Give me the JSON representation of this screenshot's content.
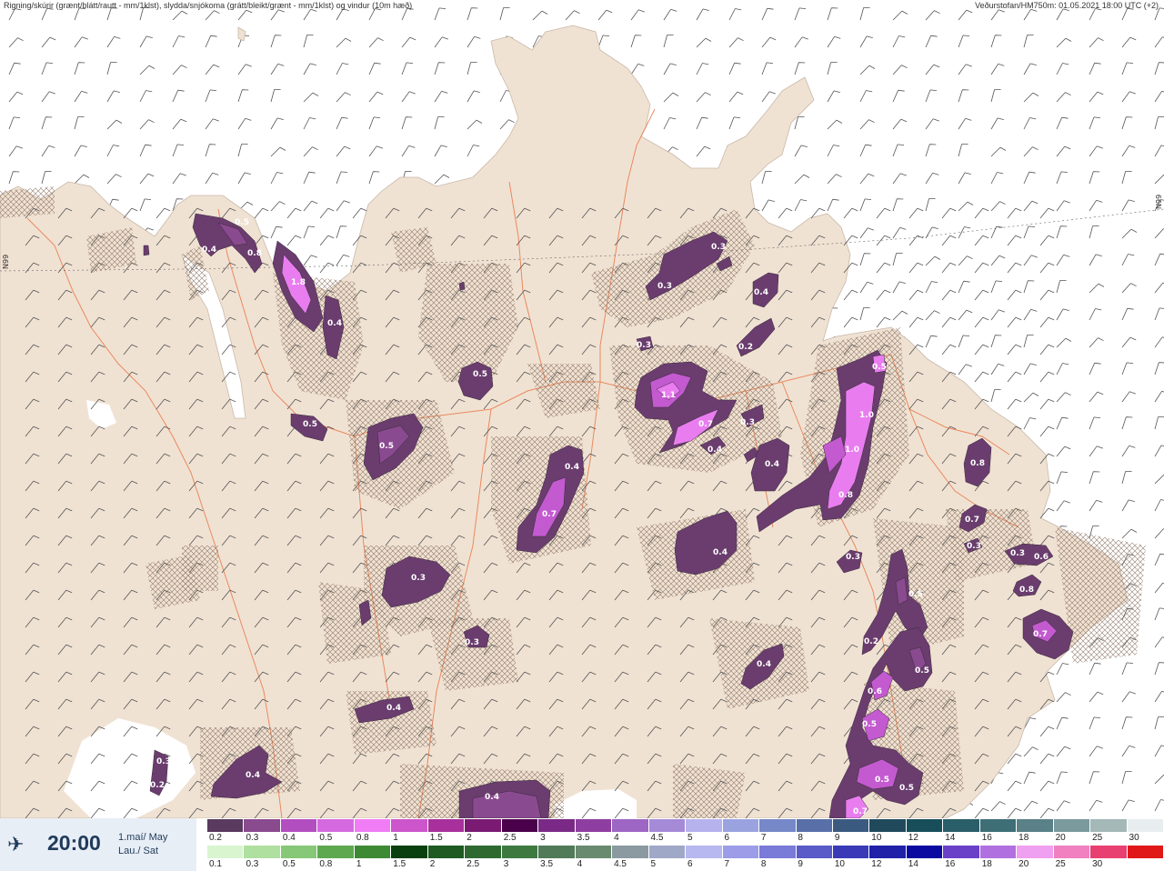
{
  "header": {
    "title_left": "Rigning/skúrir (grænt/blátt/rautt - mm/1klst), slydda/snjókoma (grátt/bleikt/grænt - mm/1klst) og vindur (10m hæð)",
    "title_right": "Veðurstofan/HM750m: 01.05.2021 18:00 UTC (+2)"
  },
  "grid_labels": {
    "left": "N99",
    "right": "N99"
  },
  "map": {
    "land_color": "#f0e2d3",
    "sea_color": "#ffffff",
    "road_color": "#e87a4a",
    "precip_colors": [
      "#6a3d6e",
      "#8a4a90",
      "#c35ad0",
      "#e97df0"
    ],
    "precip_labels": [
      {
        "id": "a1",
        "text": "0.5"
      },
      {
        "id": "a2",
        "text": "0.4"
      },
      {
        "id": "a3",
        "text": "0.8"
      },
      {
        "id": "a4",
        "text": "1.8"
      },
      {
        "id": "a5",
        "text": "0.4"
      },
      {
        "id": "a6",
        "text": "0.5"
      },
      {
        "id": "a7",
        "text": "0.5"
      },
      {
        "id": "a8",
        "text": "0.5"
      },
      {
        "id": "a9",
        "text": "0.4"
      },
      {
        "id": "a10",
        "text": "0.7"
      },
      {
        "id": "a11",
        "text": "0.3"
      },
      {
        "id": "a12",
        "text": "0.3"
      },
      {
        "id": "a13",
        "text": "0.4"
      },
      {
        "id": "a14",
        "text": "0.4"
      },
      {
        "id": "a15",
        "text": "0.3"
      },
      {
        "id": "a16",
        "text": "0.2"
      },
      {
        "id": "a17",
        "text": "0.4"
      },
      {
        "id": "a18",
        "text": "0.3"
      },
      {
        "id": "a19",
        "text": "0.3"
      },
      {
        "id": "a20",
        "text": "0.4"
      },
      {
        "id": "a21",
        "text": "0.3"
      },
      {
        "id": "a22",
        "text": "0.2"
      },
      {
        "id": "a23",
        "text": "1.1"
      },
      {
        "id": "a24",
        "text": "0.7"
      },
      {
        "id": "a25",
        "text": "0.3"
      },
      {
        "id": "a26",
        "text": "0.4"
      },
      {
        "id": "a27",
        "text": "0.4"
      },
      {
        "id": "a28",
        "text": "0.4"
      },
      {
        "id": "a29",
        "text": "0.5"
      },
      {
        "id": "a30",
        "text": "1.0"
      },
      {
        "id": "a31",
        "text": "1.0"
      },
      {
        "id": "a32",
        "text": "0.8"
      },
      {
        "id": "a33",
        "text": "0.3"
      },
      {
        "id": "a34",
        "text": "0.8"
      },
      {
        "id": "a35",
        "text": "0.7"
      },
      {
        "id": "a36",
        "text": "0.3"
      },
      {
        "id": "a37",
        "text": "0.3"
      },
      {
        "id": "a38",
        "text": "0.6"
      },
      {
        "id": "a39",
        "text": "0.8"
      },
      {
        "id": "a40",
        "text": "0.7"
      },
      {
        "id": "a41",
        "text": "0.5"
      },
      {
        "id": "a42",
        "text": "0.2"
      },
      {
        "id": "a43",
        "text": "0.5"
      },
      {
        "id": "a44",
        "text": "0.6"
      },
      {
        "id": "a45",
        "text": "0.5"
      },
      {
        "id": "a46",
        "text": "0.5"
      },
      {
        "id": "a47",
        "text": "0.5"
      },
      {
        "id": "a48",
        "text": "0.7"
      },
      {
        "id": "a49",
        "text": "0.4"
      }
    ]
  },
  "footer": {
    "time": "20:00",
    "date_line1": "1.maí/ May",
    "date_line2": "Lau./ Sat",
    "legend_top": {
      "colors": [
        "#5a3a5e",
        "#8a4a8e",
        "#b34ec0",
        "#d56ae0",
        "#f07df5",
        "#cc55cc",
        "#a8309c",
        "#7a1a72",
        "#4a004a",
        "#7a2a86",
        "#8e3ea0",
        "#9d66c4",
        "#a58ad8",
        "#b6b2ee",
        "#9aa3e0",
        "#7688c8",
        "#5870a8",
        "#3a5a80",
        "#204a5c",
        "#184e5a",
        "#2a5e68",
        "#3e6e76",
        "#5a8088",
        "#7a9a9e",
        "#a4b8b8",
        "#e8eef0"
      ],
      "labels": [
        "0.2",
        "0.3",
        "0.4",
        "0.5",
        "0.8",
        "1",
        "1.5",
        "2",
        "2.5",
        "3",
        "3.5",
        "4",
        "4.5",
        "5",
        "6",
        "7",
        "8",
        "9",
        "10",
        "12",
        "14",
        "16",
        "18",
        "20",
        "25",
        "30"
      ]
    },
    "legend_bottom": {
      "colors": [
        "#d8f5d0",
        "#b0e0a0",
        "#86c878",
        "#5ea850",
        "#3e8a34",
        "#0a4010",
        "#1e5a22",
        "#2e6a30",
        "#3e7a40",
        "#507a58",
        "#6a8a70",
        "#8a9aa0",
        "#a0a8c8",
        "#b8b8f0",
        "#9c9ce8",
        "#7a7ad8",
        "#5a5ac8",
        "#3a3ab8",
        "#2020a8",
        "#0a0aa0",
        "#6a40c8",
        "#b070e0",
        "#f0a0f0",
        "#f080c0",
        "#e84070",
        "#e01818"
      ],
      "labels": [
        "0.1",
        "0.3",
        "0.5",
        "0.8",
        "1",
        "1.5",
        "2",
        "2.5",
        "3",
        "3.5",
        "4",
        "4.5",
        "5",
        "6",
        "7",
        "8",
        "9",
        "10",
        "12",
        "14",
        "16",
        "18",
        "20",
        "25",
        "30",
        ""
      ]
    }
  }
}
